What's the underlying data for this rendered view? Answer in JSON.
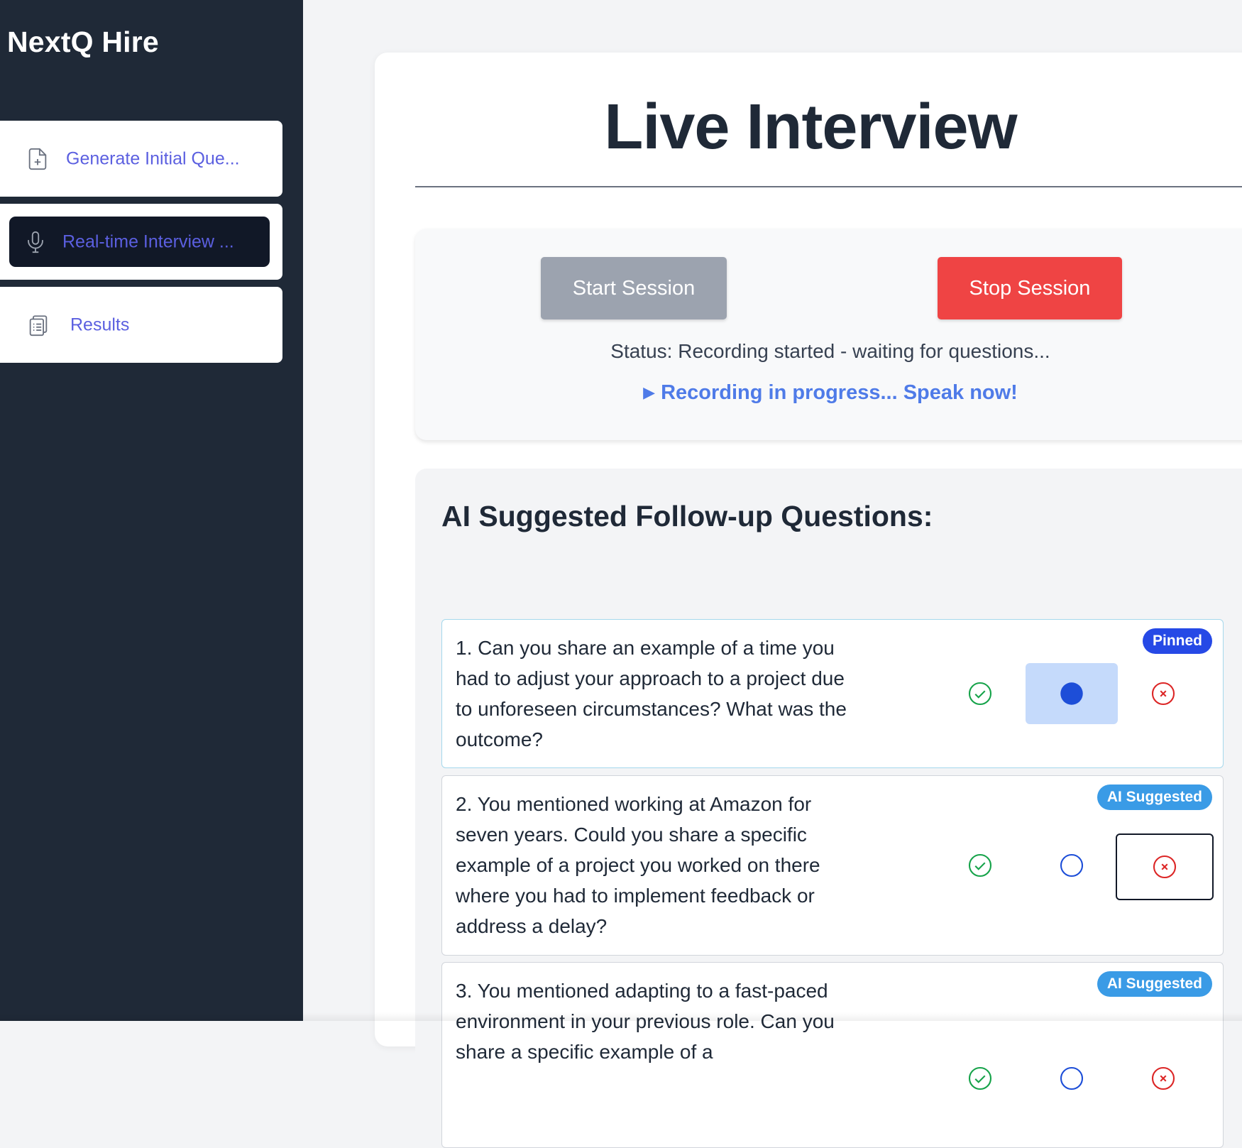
{
  "app": {
    "brand": "NextQ Hire"
  },
  "sidebar": {
    "items": [
      {
        "label": "Generate Initial Que...",
        "icon": "file-plus-icon",
        "active": false
      },
      {
        "label": "Real-time Interview ...",
        "icon": "microphone-icon",
        "active": true
      },
      {
        "label": "Results",
        "icon": "clipboard-list-icon",
        "active": false
      }
    ]
  },
  "main": {
    "title": "Live Interview",
    "session": {
      "start_label": "Start Session",
      "stop_label": "Stop Session",
      "status": "Status: Recording started - waiting for questions...",
      "recording_icon": "play-icon",
      "recording_text": "Recording in progress... Speak now!"
    },
    "followups": {
      "heading": "AI Suggested Follow-up Questions:",
      "questions": [
        {
          "text": "1. Can you share an example of a time you had to adjust your approach to a project due to unforeseen circumstances? What was the outcome?",
          "badge": "Pinned",
          "state": "pinned"
        },
        {
          "text": "2. You mentioned working at Amazon for seven years. Could you share a specific example of a project you worked on there where you had to implement feedback or address a delay?",
          "badge": "AI Suggested",
          "state": "suggested"
        },
        {
          "text": "3. You mentioned adapting to a fast-paced environment in your previous role. Can you share a specific example of a",
          "badge": "AI Suggested",
          "state": "suggested"
        }
      ]
    }
  },
  "colors": {
    "sidebar_bg": "#1f2937",
    "accent": "#5b5fe0",
    "stop": "#ef4444",
    "start_disabled": "#9ca3af",
    "accept": "#16a34a",
    "pin": "#1d4ed8",
    "reject": "#dc2626"
  }
}
